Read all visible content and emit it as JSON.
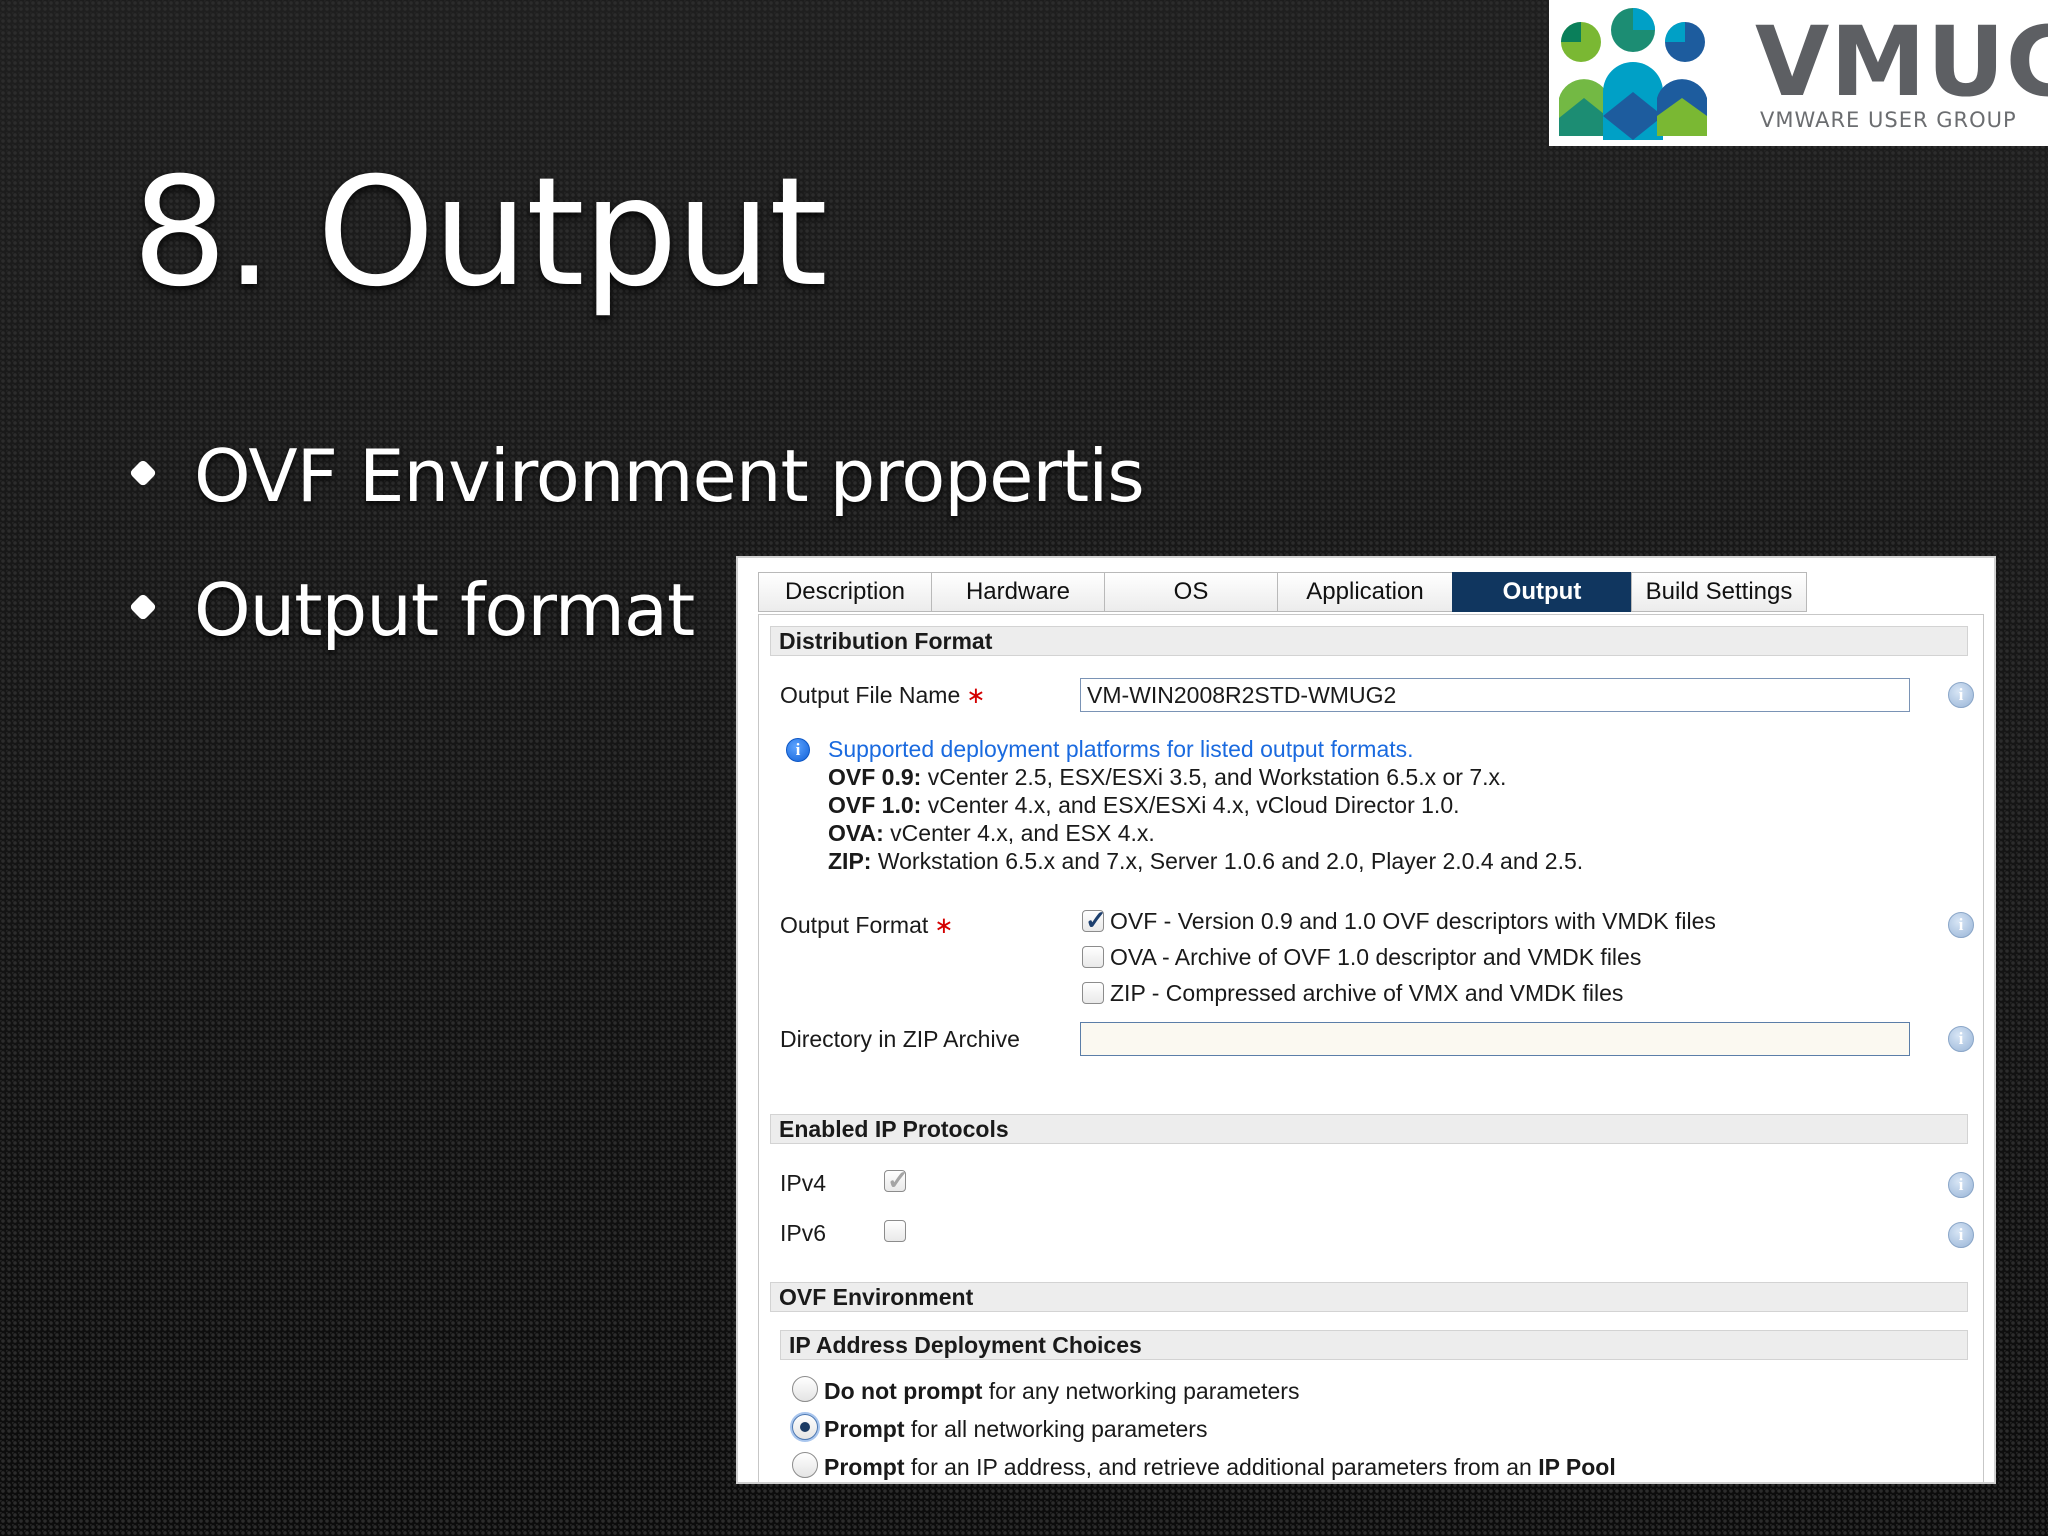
{
  "slide": {
    "title": "8. Output",
    "bullets": [
      "OVF Environment propertis",
      "Output format"
    ]
  },
  "logo": {
    "word": "VMUG",
    "tagline": "VMWARE USER GROUP",
    "colors": [
      "#7ab833",
      "#1c8d73",
      "#00a0c6",
      "#1d5c9e",
      "#73b944",
      "#0a7f5a"
    ]
  },
  "tabs": {
    "items": [
      "Description",
      "Hardware",
      "OS",
      "Application",
      "Output",
      "Build Settings"
    ],
    "active": "Output"
  },
  "distribution": {
    "header": "Distribution Format",
    "file_name_label": "Output File Name",
    "required_mark": "∗",
    "file_name_value": "VM-WIN2008R2STD-WMUG2",
    "note_link": "Supported deployment platforms for listed output formats.",
    "notes": [
      {
        "key": "OVF 0.9:",
        "text": " vCenter 2.5, ESX/ESXi 3.5, and Workstation 6.5.x or 7.x."
      },
      {
        "key": "OVF 1.0:",
        "text": " vCenter 4.x, and ESX/ESXi 4.x, vCloud Director 1.0."
      },
      {
        "key": "OVA:",
        "text": " vCenter 4.x, and ESX 4.x."
      },
      {
        "key": "ZIP:",
        "text": " Workstation 6.5.x and 7.x, Server 1.0.6 and 2.0, Player 2.0.4 and 2.5."
      }
    ],
    "output_format_label": "Output Format",
    "formats": [
      {
        "label": "OVF - Version 0.9 and 1.0 OVF descriptors with VMDK files",
        "checked": true
      },
      {
        "label": "OVA - Archive of OVF 1.0 descriptor and VMDK files",
        "checked": false
      },
      {
        "label": "ZIP - Compressed archive of VMX and VMDK files",
        "checked": false
      }
    ],
    "zip_dir_label": "Directory in ZIP Archive",
    "zip_dir_value": ""
  },
  "ip_protocols": {
    "header": "Enabled IP Protocols",
    "ipv4_label": "IPv4",
    "ipv4_checked": true,
    "ipv6_label": "IPv6",
    "ipv6_checked": false
  },
  "ovf_env": {
    "header": "OVF Environment",
    "sub_header": "IP Address Deployment Choices",
    "choices": [
      {
        "bold": "Do not prompt",
        "text": " for any networking parameters",
        "selected": false
      },
      {
        "bold": "Prompt",
        "text": " for all networking parameters",
        "selected": true
      },
      {
        "bold": "Prompt",
        "text": " for an IP address, and retrieve additional parameters from an ",
        "bold2": "IP Pool",
        "selected": false
      }
    ]
  }
}
